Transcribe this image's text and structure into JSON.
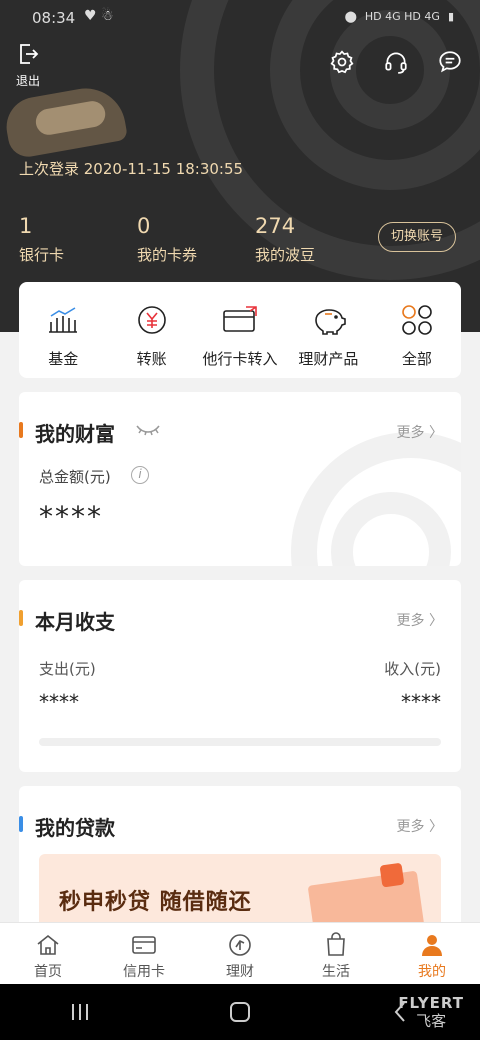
{
  "status_bar": {
    "time": "08:34",
    "network": "HD 4G HD 4G"
  },
  "header": {
    "logout_label": "退出",
    "last_login": "上次登录 2020-11-15 18:30:55",
    "stats": [
      {
        "value": "1",
        "label": "银行卡"
      },
      {
        "value": "0",
        "label": "我的卡券"
      },
      {
        "value": "274",
        "label": "我的波豆"
      }
    ],
    "switch_account": "切换账号"
  },
  "quick_actions": [
    {
      "label": "基金",
      "icon": "bar-chart-icon"
    },
    {
      "label": "转账",
      "icon": "yuan-transfer-icon"
    },
    {
      "label": "他行卡转入",
      "icon": "card-transfer-icon"
    },
    {
      "label": "理财产品",
      "icon": "piggy-bank-icon"
    },
    {
      "label": "全部",
      "icon": "grid-circles-icon"
    }
  ],
  "wealth": {
    "title": "我的财富",
    "more": "更多 〉",
    "total_label": "总金额(元)",
    "total_value": "****"
  },
  "monthly": {
    "title": "本月收支",
    "more": "更多 〉",
    "expense_label": "支出(元)",
    "income_label": "收入(元)",
    "expense_value": "****",
    "income_value": "****"
  },
  "loan": {
    "title": "我的贷款",
    "more": "更多 〉",
    "banner": "秒申秒贷 随借随还"
  },
  "tabs": [
    {
      "label": "首页",
      "active": false
    },
    {
      "label": "信用卡",
      "active": false
    },
    {
      "label": "理财",
      "active": false
    },
    {
      "label": "生活",
      "active": false
    },
    {
      "label": "我的",
      "active": true
    }
  ],
  "watermark": {
    "top": "FLYERT",
    "bottom": "飞客"
  },
  "colors": {
    "accent": "#e8791e",
    "header_bg": "#2c2c2c",
    "gold_text": "#f0d9b0",
    "wealth_bar": "#e8791e",
    "monthly_bar": "#f0a030",
    "loan_bar": "#3a8ee6"
  }
}
